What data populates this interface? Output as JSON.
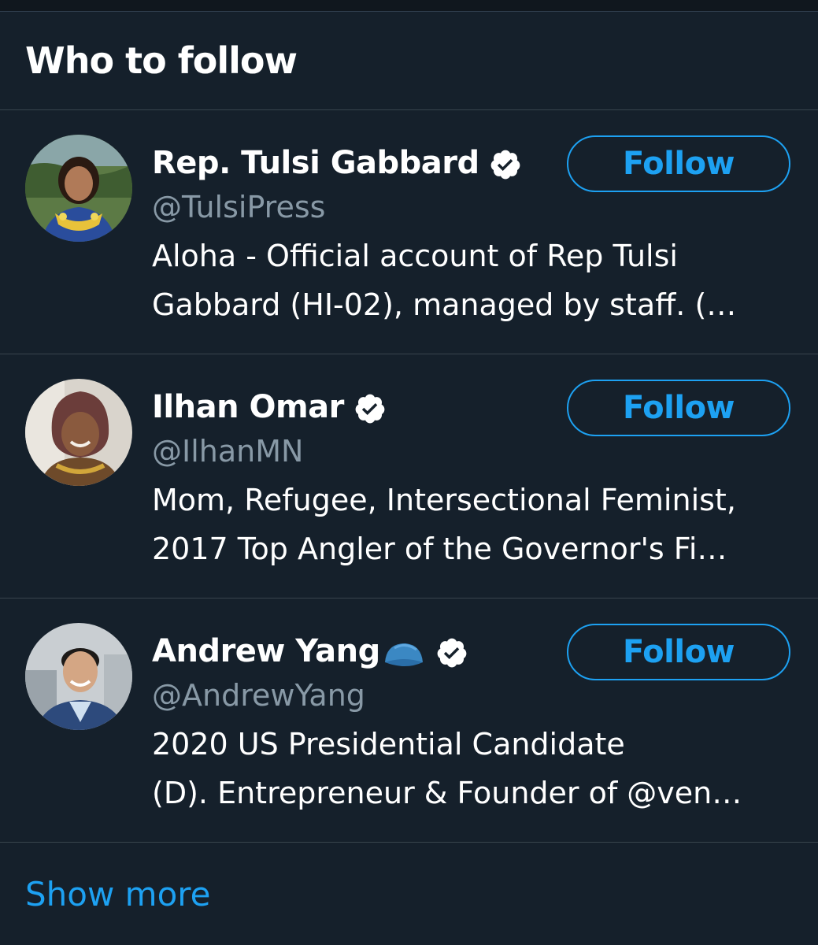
{
  "widget": {
    "title": "Who to follow",
    "show_more_label": "Show more"
  },
  "users": [
    {
      "name": "Rep. Tulsi Gabbard",
      "handle": "@TulsiPress",
      "bio_line1": "Aloha - Official account of Rep Tulsi",
      "bio_line2": "Gabbard (HI-02), managed by staff. (…",
      "verified": true,
      "follow_label": "Follow"
    },
    {
      "name": "Ilhan Omar",
      "handle": "@IlhanMN",
      "bio_line1": "Mom, Refugee, Intersectional Feminist,",
      "bio_line2": "2017 Top Angler of the Governor's Fi…",
      "verified": true,
      "follow_label": "Follow"
    },
    {
      "name": "Andrew Yang",
      "name_emoji": "cap-icon",
      "handle": "@AndrewYang",
      "bio_line1": "2020 US Presidential Candidate",
      "bio_line2": "(D). Entrepreneur & Founder of @ven…",
      "verified": true,
      "follow_label": "Follow"
    }
  ],
  "colors": {
    "background": "#15202b",
    "divider": "#38444d",
    "accent": "#1da1f2",
    "secondary_text": "#8899a6",
    "primary_text": "#ffffff"
  }
}
